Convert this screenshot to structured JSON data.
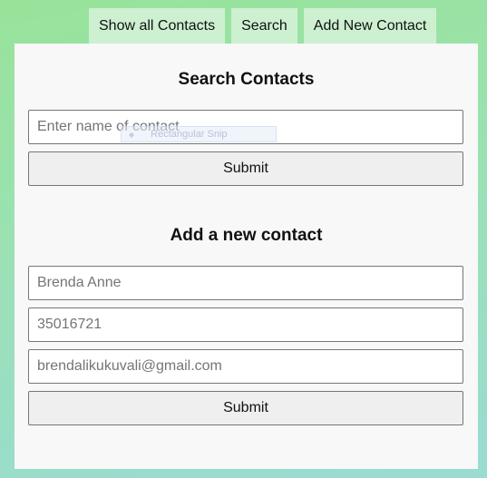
{
  "nav": {
    "tabs": [
      {
        "label": "Show all Contacts"
      },
      {
        "label": "Search"
      },
      {
        "label": "Add New Contact"
      }
    ]
  },
  "search": {
    "title": "Search Contacts",
    "placeholder": "Enter name of contact",
    "submit_label": "Submit"
  },
  "add_contact": {
    "title": "Add a new contact",
    "name_value": "Brenda Anne",
    "phone_value": "35016721",
    "email_value": "brendalikukuvali@gmail.com",
    "submit_label": "Submit"
  },
  "overlay": {
    "snip_label": "Rectangular Snip",
    "snip_icon": "snip-icon"
  }
}
